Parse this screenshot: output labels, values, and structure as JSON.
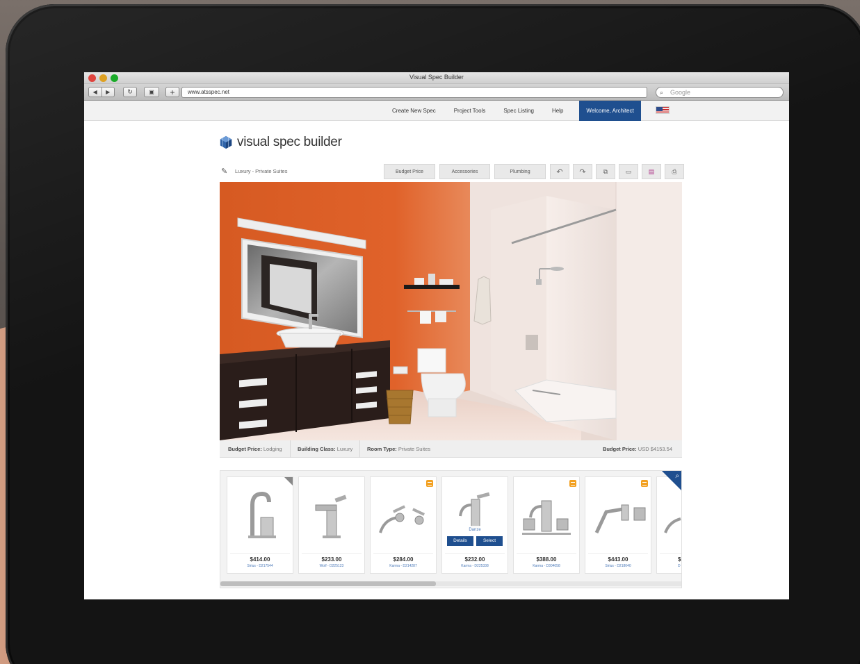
{
  "window": {
    "title": "Visual Spec Builder"
  },
  "browser": {
    "back_icon": "back-arrow-icon",
    "forward_icon": "forward-arrow-icon",
    "url": "www.atsspec.net",
    "search_placeholder": "Google"
  },
  "nav": {
    "items": [
      {
        "label": "Create New Spec"
      },
      {
        "label": "Project Tools"
      },
      {
        "label": "Spec Listing"
      },
      {
        "label": "Help"
      }
    ],
    "welcome": "Welcome, Architect"
  },
  "logo": {
    "text": "visual spec builder"
  },
  "spec": {
    "name": "Luxury - Private Suites",
    "buttons": [
      "Budget Price",
      "Accessories",
      "Plumbing"
    ],
    "icons": [
      "undo-icon",
      "redo-icon",
      "copy-icon",
      "save-icon",
      "export-icon",
      "print-icon"
    ]
  },
  "info": {
    "budget_label": "Budget Price:",
    "budget_value": "Lodging",
    "class_label": "Building Class:",
    "class_value": "Luxury",
    "room_label": "Room Type:",
    "room_value": "Private Suites",
    "total_label": "Budget Price:",
    "total_value": "USD $4153.54"
  },
  "products": [
    {
      "price": "$414.00",
      "sku": "Sirius - D217544",
      "badge": "corner"
    },
    {
      "price": "$233.00",
      "sku": "Wolf - D225123",
      "badge": "none"
    },
    {
      "price": "$284.00",
      "sku": "Karma - D214287",
      "badge": "orange"
    },
    {
      "price": "$232.00",
      "sku": "Karma - D225338",
      "badge": "none",
      "hover_name": "Danze",
      "details_label": "Details",
      "select_label": "Select"
    },
    {
      "price": "$388.00",
      "sku": "Karma - D304058",
      "badge": "orange"
    },
    {
      "price": "$443.00",
      "sku": "Sirius - D218040",
      "badge": "orange"
    },
    {
      "price": "$",
      "sku": "D",
      "badge": "none"
    }
  ],
  "colors": {
    "accent": "#1f4f8f",
    "wall": "#d65b25",
    "badge": "#f2a020"
  }
}
